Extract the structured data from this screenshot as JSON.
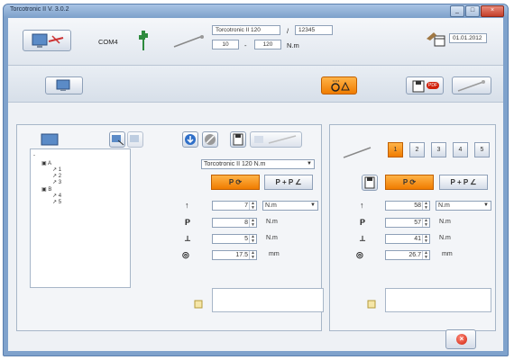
{
  "window": {
    "title": "Torcotronic II V. 3.0.2",
    "controls": [
      "_",
      "□",
      "×"
    ]
  },
  "header": {
    "port": "COM4",
    "device_name": "Torcotronic II 120",
    "separator": "/",
    "serial": "12345",
    "range_min": "10",
    "range_dash": "-",
    "range_max": "120",
    "range_unit": "N.m",
    "date": "01.01.2012"
  },
  "toolbar": {
    "report_badge": "PDF"
  },
  "left": {
    "tree": {
      "root": "-",
      "nodes": [
        "A",
        "1",
        "2",
        "3",
        "B",
        "4",
        "5"
      ]
    },
    "tool_select": "Torcotronic II 120 N.m",
    "mode_tabs": [
      "P",
      "P + P"
    ],
    "rows": [
      {
        "value": "7",
        "unit": "N.m",
        "unit_dropdown": true
      },
      {
        "value": "8",
        "unit": "N.m"
      },
      {
        "value": "5",
        "unit": "N.m"
      },
      {
        "value": "17.5",
        "unit": "mm"
      }
    ]
  },
  "right": {
    "pages": [
      "1",
      "2",
      "3",
      "4",
      "5"
    ],
    "active_page": "1",
    "mode_tabs": [
      "P",
      "P + P"
    ],
    "rows": [
      {
        "value": "58",
        "unit": "N.m",
        "unit_dropdown": true
      },
      {
        "value": "57",
        "unit": "N.m"
      },
      {
        "value": "41",
        "unit": "N.m"
      },
      {
        "value": "26.7",
        "unit": "mm"
      }
    ]
  },
  "icons": {
    "symbols": [
      "↑",
      "P",
      "⟂",
      "◎"
    ]
  },
  "colors": {
    "accent": "#f07c00",
    "window_frame": "#7fa2cc",
    "exit": "#d0200a"
  }
}
